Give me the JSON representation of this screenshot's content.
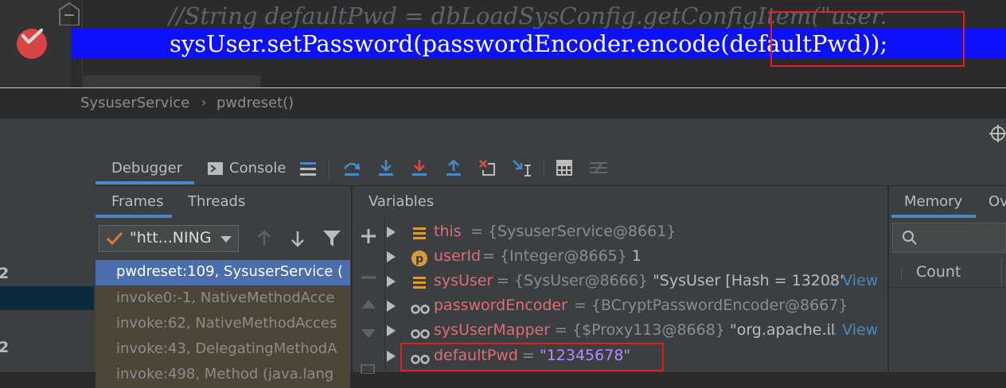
{
  "editor": {
    "comment_line": "//String defaultPwd = dbLoadSysConfig.getConfigItem(\"user.",
    "current_line": "sysUser.setPassword(passwordEncoder.encode(defaultPwd));"
  },
  "breadcrumb": {
    "class_name": "SysuserService",
    "separator": "›",
    "method_name": "pwdreset()"
  },
  "left_strip": {
    "numbers": [
      "2",
      "2"
    ]
  },
  "debug_toolbar": {
    "debugger_tab": "Debugger",
    "console_tab": "Console"
  },
  "frames_panel": {
    "frames_tab": "Frames",
    "threads_tab": "Threads",
    "thread_selected": "\"htt...NING",
    "frames": [
      "pwdreset:109, SysuserService (",
      "invoke0:-1, NativeMethodAcce",
      "invoke:62, NativeMethodAcces",
      "invoke:43, DelegatingMethodA",
      "invoke:498, Method (java.lang"
    ]
  },
  "variables_panel": {
    "title": "Variables",
    "items": [
      {
        "name": "this",
        "eq": "=",
        "ref": "{SysuserService@8661}",
        "value": "",
        "link": ""
      },
      {
        "name": "userId",
        "eq": "=",
        "ref": "{Integer@8665}",
        "value": "1",
        "link": ""
      },
      {
        "name": "sysUser",
        "eq": "=",
        "ref": "{SysUser@8666}",
        "value": "\"SysUser [Hash = 13208'",
        "link": "... View"
      },
      {
        "name": "passwordEncoder",
        "eq": "=",
        "ref": "{BCryptPasswordEncoder@8667}",
        "value": "",
        "link": ""
      },
      {
        "name": "sysUserMapper",
        "eq": "=",
        "ref": "{$Proxy113@8668}",
        "value": "\"org.apache.il",
        "link": "... View"
      },
      {
        "name": "defaultPwd",
        "eq": "=",
        "ref": "",
        "value": "\"12345678\"",
        "link": ""
      }
    ]
  },
  "memory_panel": {
    "memory_tab": "Memory",
    "overhead_tab": "Ov",
    "count_header": "Count"
  },
  "colors": {
    "exec_line": "#0c10ff",
    "highlight_box": "#e02020",
    "var_name": "#e06c75",
    "string_value": "#b58bff"
  }
}
